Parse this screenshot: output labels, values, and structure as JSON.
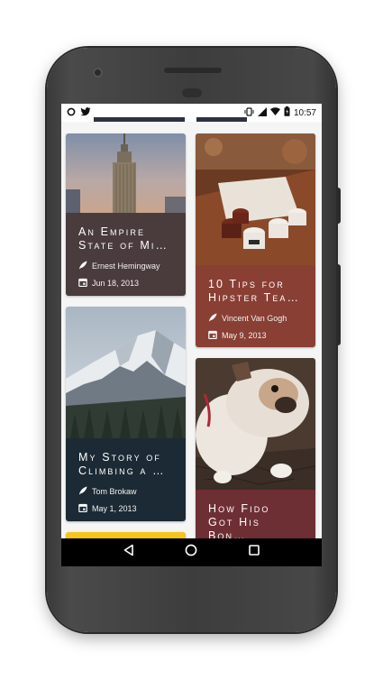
{
  "status_bar": {
    "time": "10:57",
    "left_icons": [
      "camera-ring-icon",
      "twitter-bird-icon"
    ],
    "right_icons": [
      "vibrate-icon",
      "signal-icon",
      "wifi-icon",
      "battery-icon"
    ]
  },
  "cards": [
    {
      "id": "empire",
      "title_line1": "An Empire",
      "title_line2": "State of Mi…",
      "author": "Ernest Hemingway",
      "date": "Jun 18, 2013",
      "body_color": "#4a3b3d"
    },
    {
      "id": "hipster",
      "title_line1": "10 Tips for",
      "title_line2": "Hipster Tea…",
      "author": "Vincent Van Gogh",
      "date": "May 9, 2013",
      "body_color": "#8a3f34"
    },
    {
      "id": "climbing",
      "title_line1": "My Story of",
      "title_line2": "Climbing a …",
      "author": "Tom Brokaw",
      "date": "May 1, 2013",
      "body_color": "#1b2a34"
    },
    {
      "id": "fido",
      "title_line1": "How Fido",
      "title_line2": "Got His Bon…",
      "author": "",
      "date": "",
      "body_color": "#6e2f34"
    }
  ],
  "colors": {
    "partial_card_yellow": "#f5c518",
    "nav_bar": "#000000",
    "screen_bg": "#f5f5f5"
  },
  "nav_bar": {
    "icons": [
      "back-triangle-icon",
      "home-circle-icon",
      "recents-square-icon"
    ]
  }
}
